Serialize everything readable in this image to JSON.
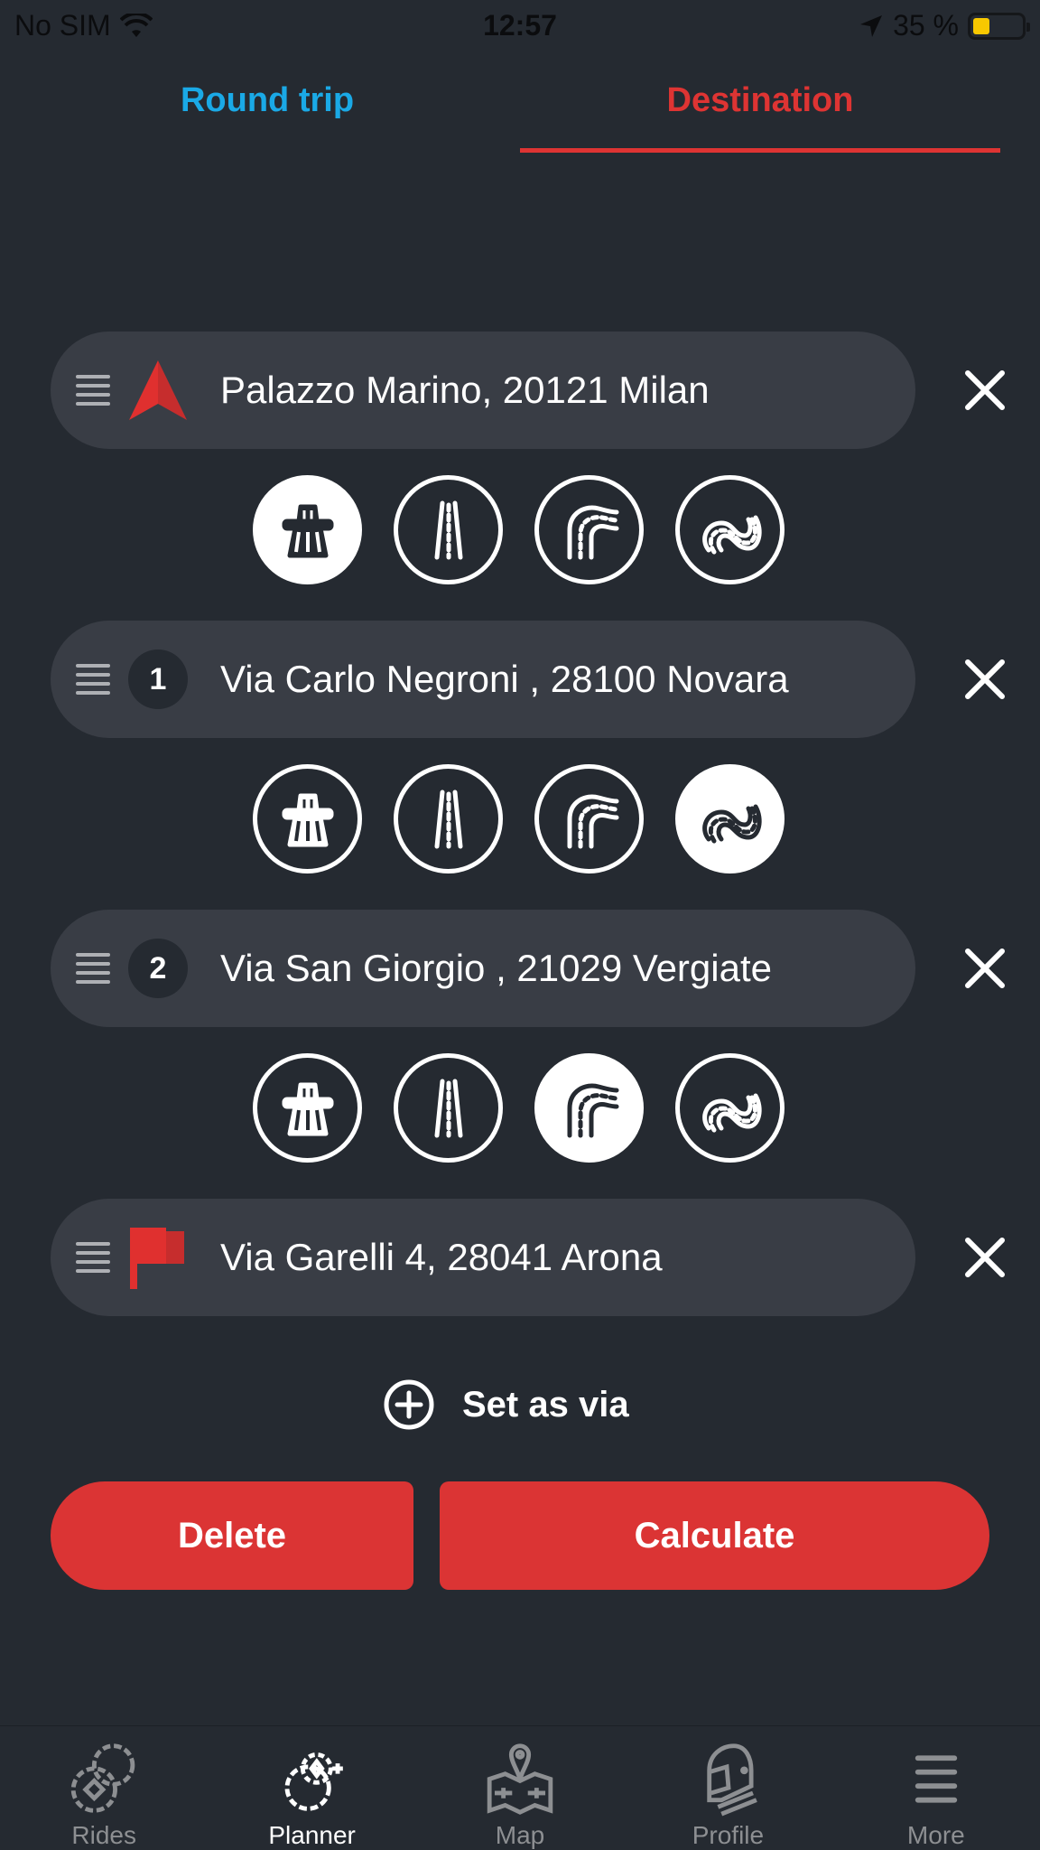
{
  "status_bar": {
    "carrier": "No SIM",
    "time": "12:57",
    "battery_text": "35 %",
    "battery_level_percent": 35,
    "icons": [
      "wifi-icon",
      "location-arrow-icon",
      "battery-icon"
    ]
  },
  "tabs": [
    {
      "label": "Round trip",
      "active": false,
      "color": "#1aa9e6"
    },
    {
      "label": "Destination",
      "active": true,
      "color": "#de3433"
    }
  ],
  "waypoints": [
    {
      "type": "start",
      "marker": "start-arrow-icon",
      "label": "Palazzo Marino, 20121 Milan"
    },
    {
      "type": "via",
      "marker_number": "1",
      "label": "Via Carlo Negroni , 28100 Novara"
    },
    {
      "type": "via",
      "marker_number": "2",
      "label": "Via San Giorgio , 21029 Vergiate"
    },
    {
      "type": "destination",
      "marker": "finish-flag-icon",
      "label": "Via Garelli 4, 28041 Arona"
    }
  ],
  "route_style_options": [
    "highway",
    "straight-road",
    "curvy-road",
    "very-curvy-road"
  ],
  "route_segments": [
    {
      "selected_style": "highway"
    },
    {
      "selected_style": "very-curvy-road"
    },
    {
      "selected_style": "curvy-road"
    }
  ],
  "actions": {
    "set_as_via": "Set as via",
    "delete": "Delete",
    "calculate": "Calculate"
  },
  "tab_bar": [
    {
      "label": "Rides",
      "icon": "rides-icon",
      "active": false
    },
    {
      "label": "Planner",
      "icon": "planner-icon",
      "active": true
    },
    {
      "label": "Map",
      "icon": "map-icon",
      "active": false
    },
    {
      "label": "Profile",
      "icon": "helmet-icon",
      "active": false
    },
    {
      "label": "More",
      "icon": "menu-icon",
      "active": false
    }
  ],
  "colors": {
    "background": "#252a31",
    "row_background": "#393d45",
    "accent_red": "#db3434",
    "accent_blue": "#1aa9e6",
    "battery_yellow": "#f8c800"
  }
}
